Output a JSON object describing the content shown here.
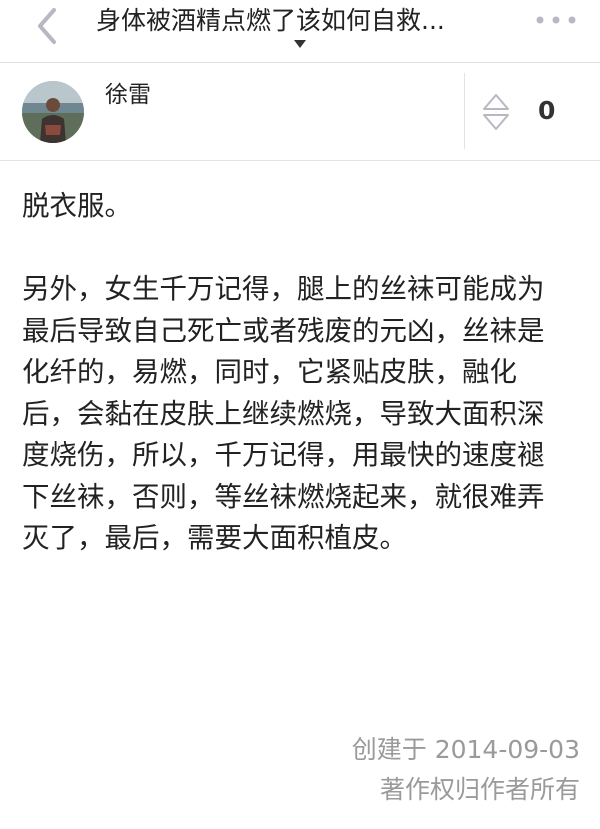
{
  "header": {
    "back_icon": "chevron-left-icon",
    "title": "身体被酒精点燃了该如何自救...",
    "dropdown_icon": "caret-down-icon",
    "more_icon": "more-dots-icon"
  },
  "author": {
    "avatar_icon": "user-avatar-icon",
    "name": "徐雷",
    "vote_icon": "vote-arrows-icon",
    "vote_count": "0"
  },
  "answer": {
    "paragraphs": [
      "脱衣服。",
      "另外，女生千万记得，腿上的丝袜可能成为最后导致自己死亡或者残废的元凶，丝袜是化纤的，易燃，同时，它紧贴皮肤，融化后，会黏在皮肤上继续燃烧，导致大面积深度烧伤，所以，千万记得，用最快的速度褪下丝袜，否则，等丝袜燃烧起来，就很难弄灭了，最后，需要大面积植皮。"
    ]
  },
  "footer": {
    "created": "创建于 2014-09-03",
    "copyright": "著作权归作者所有"
  },
  "colors": {
    "text": "#222222",
    "muted": "#9a9a9a",
    "icon": "#b8b8c4",
    "divider": "#e3e3e3"
  }
}
